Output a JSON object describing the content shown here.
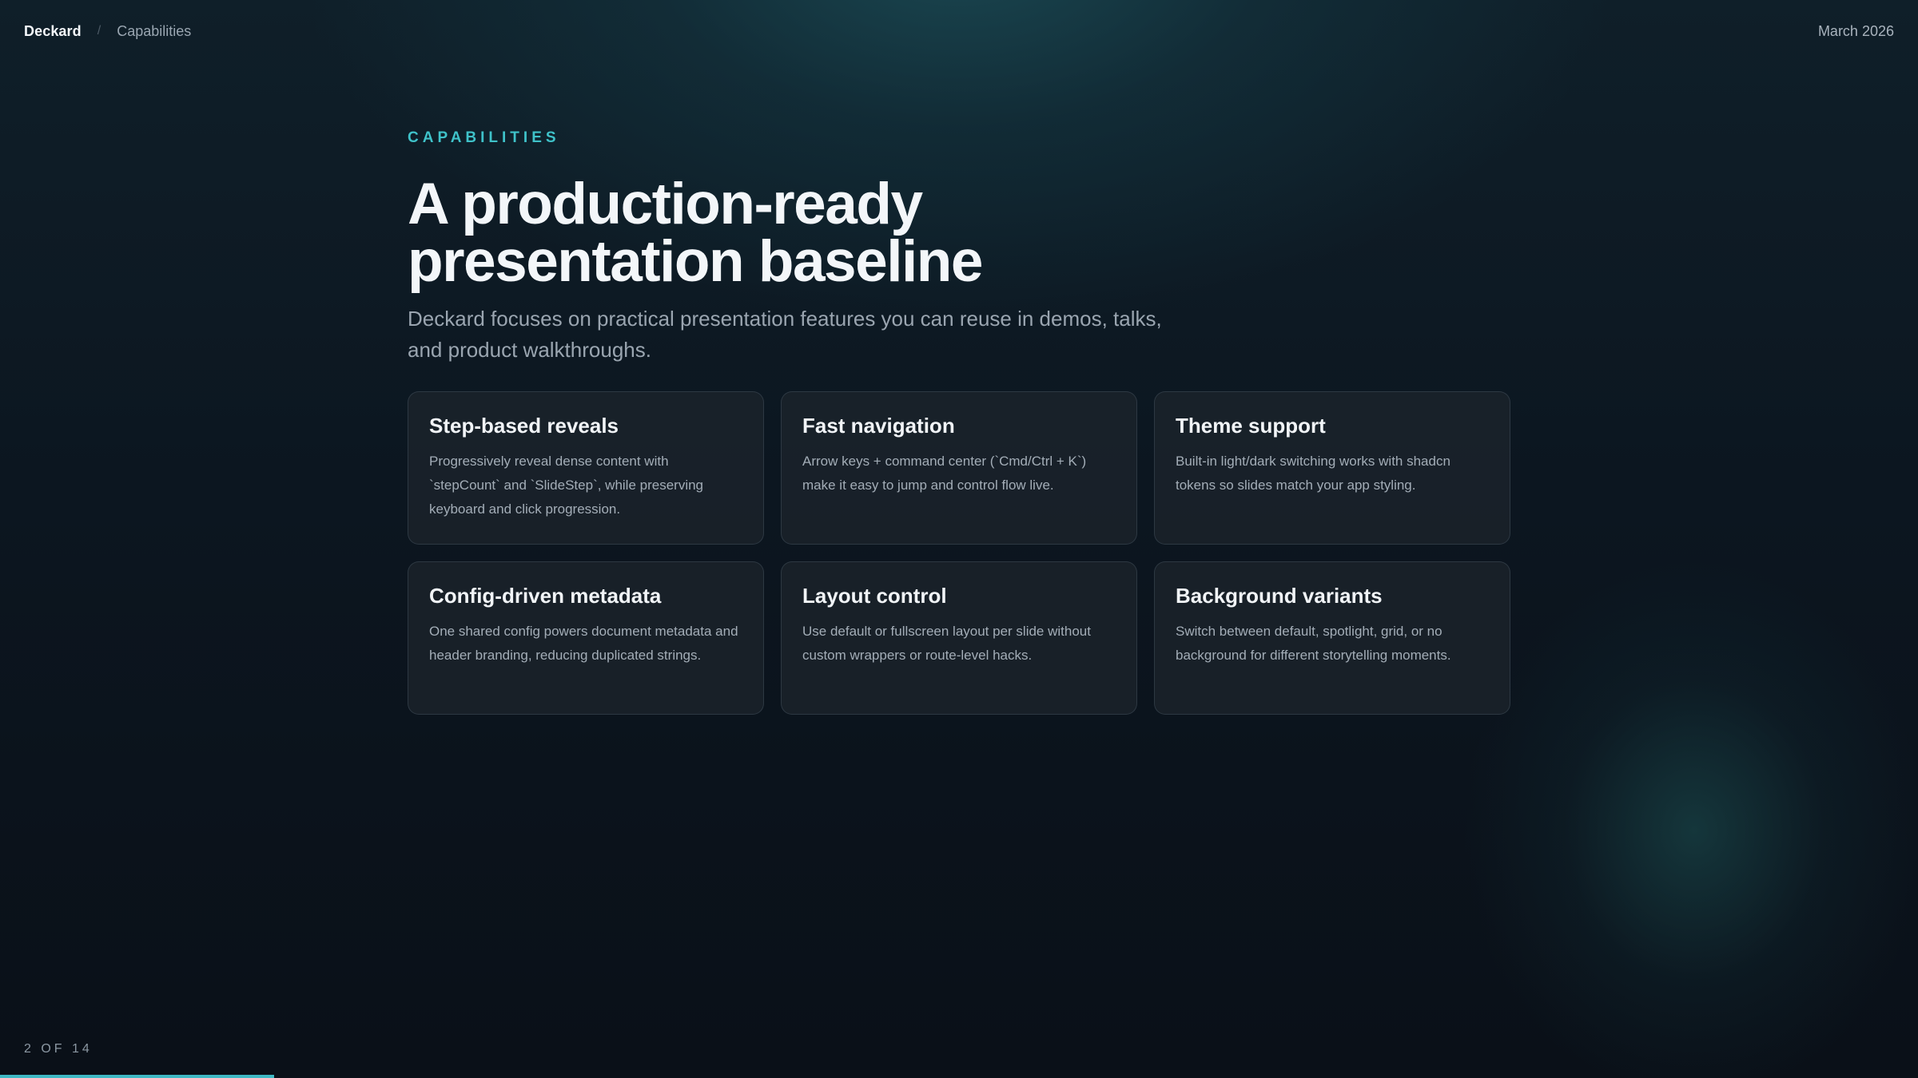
{
  "header": {
    "brand": "Deckard",
    "separator": "/",
    "breadcrumb": "Capabilities",
    "date": "March 2026"
  },
  "slide": {
    "eyebrow": "CAPABILITIES",
    "title_line1": "A production-ready",
    "title_line2": "presentation baseline",
    "subtitle": "Deckard focuses on practical presentation features you can reuse in demos, talks, and product walkthroughs.",
    "cards": [
      {
        "title": "Step-based reveals",
        "description": "Progressively reveal dense content with `stepCount` and `SlideStep`, while preserving keyboard and click progression."
      },
      {
        "title": "Fast navigation",
        "description": "Arrow keys + command center (`Cmd/Ctrl + K`) make it easy to jump and control flow live."
      },
      {
        "title": "Theme support",
        "description": "Built-in light/dark switching works with shadcn tokens so slides match your app styling."
      },
      {
        "title": "Config-driven metadata",
        "description": "One shared config powers document metadata and header branding, reducing duplicated strings."
      },
      {
        "title": "Layout control",
        "description": "Use default or fullscreen layout per slide without custom wrappers or route-level hacks."
      },
      {
        "title": "Background variants",
        "description": "Switch between default, spotlight, grid, or no background for different storytelling moments."
      }
    ]
  },
  "footer": {
    "counter": "2 OF 14",
    "progress_fraction": 0.1428
  },
  "colors": {
    "accent": "#3fc2c9",
    "progress": "#3fb8c4",
    "background": "#0b1119"
  }
}
